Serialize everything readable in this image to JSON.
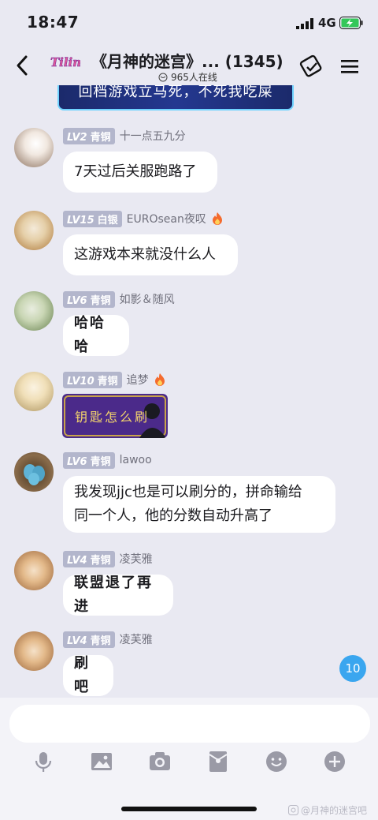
{
  "status_bar": {
    "time": "18:47",
    "network": "4G"
  },
  "header": {
    "logo_text": "Tiling",
    "title": "《月神的迷宫》... (1345)",
    "online": "965人在线"
  },
  "banner_text": "回档游戏立马死，不死我吃屎",
  "messages": [
    {
      "level": "LV2",
      "rank": "青铜",
      "name": "十一点五九分",
      "text": "7天过后关服跑路了"
    },
    {
      "level": "LV15",
      "rank": "白银",
      "name": "EUROsean夜叹",
      "text": "这游戏本来就没什么人"
    },
    {
      "level": "LV6",
      "rank": "青铜",
      "name": "如影＆随风",
      "text": "哈哈哈"
    },
    {
      "level": "LV10",
      "rank": "青铜",
      "name": "追梦",
      "sticker_text": "钥匙怎么刷"
    },
    {
      "level": "LV6",
      "rank": "青铜",
      "name": "lawoo",
      "text_line1": "我发现jjc也是可以刷分的，拼命输给",
      "text_line2": "同一个人，他的分数自动升高了"
    },
    {
      "level": "LV4",
      "rank": "青铜",
      "name": "凌芙雅",
      "text": "联盟退了再进"
    },
    {
      "level": "LV4",
      "rank": "青铜",
      "name": "凌芙雅",
      "text": "刷吧"
    }
  ],
  "unread_count": "10",
  "input": {
    "placeholder": ""
  },
  "toolbar": [
    "microphone-icon",
    "image-icon",
    "camera-icon",
    "red-packet-icon",
    "emoji-icon",
    "plus-icon"
  ],
  "watermark": "@月神的迷宫吧",
  "colors": {
    "background": "#e9e9f2",
    "badge": "#b3b6cc",
    "unread": "#3aa6ef",
    "banner": "#1b2a6b"
  }
}
